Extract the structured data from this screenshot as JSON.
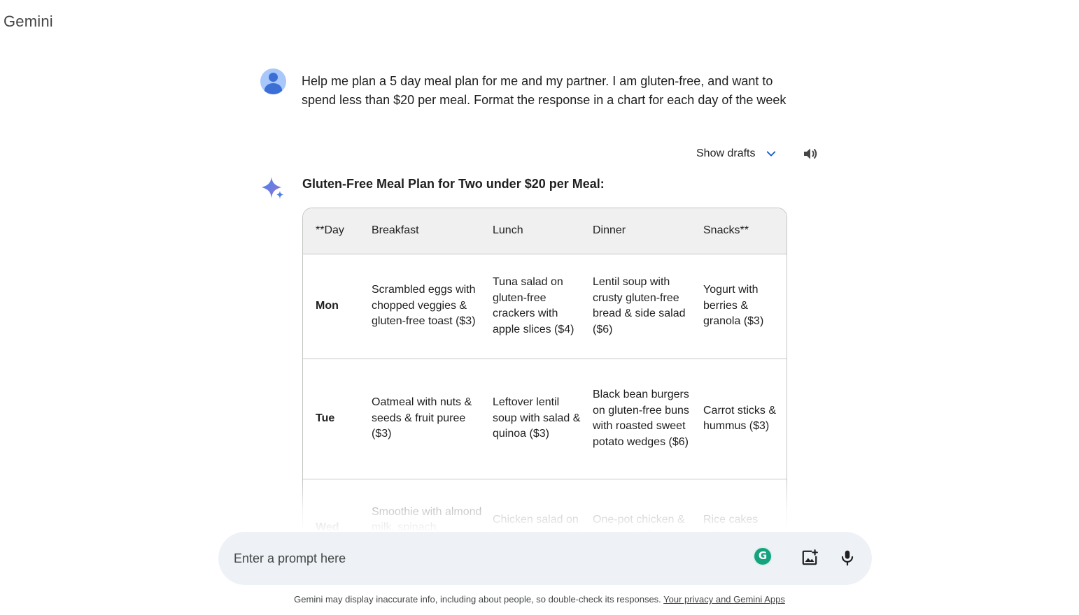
{
  "app": {
    "title": "Gemini"
  },
  "user_message": {
    "text": "Help me plan a 5 day meal plan for me and my partner. I am gluten-free, and want to spend less than $20 per meal. Format the response in a chart for each day of the week"
  },
  "drafts": {
    "label": "Show drafts",
    "icon": "chevron-down-icon"
  },
  "speaker": {
    "icon": "speaker-icon"
  },
  "response": {
    "title": "Gluten-Free Meal Plan for Two under $20 per Meal:",
    "table": {
      "headers": [
        "**Day",
        "Breakfast",
        "Lunch",
        "Dinner",
        "Snacks**"
      ],
      "rows": [
        [
          "Mon",
          "Scrambled eggs with chopped veggies & gluten-free toast ($3)",
          "Tuna salad on gluten-free crackers with apple slices ($4)",
          "Lentil soup with crusty gluten-free bread & side salad ($6)",
          "Yogurt with berries & granola ($3)"
        ],
        [
          "Tue",
          "Oatmeal with nuts & seeds & fruit puree ($3)",
          "Leftover lentil soup with salad & quinoa ($3)",
          "Black bean burgers on gluten-free buns with roasted sweet potato wedges ($6)",
          "Carrot sticks & hummus ($3)"
        ],
        [
          "Wed",
          "Smoothie with almond milk, spinach, banana, &",
          "Chicken salad on lettuce wraps with",
          "One-pot chicken & veggie stir-fry",
          "Rice cakes with avocado"
        ]
      ]
    }
  },
  "input": {
    "placeholder": "Enter a prompt here"
  },
  "footer": {
    "text": "Gemini may display inaccurate info, including about people, so double-check its responses. ",
    "link": "Your privacy and Gemini Apps"
  },
  "colors": {
    "accent": "#0b57d0",
    "input_bg": "#eef1f6",
    "grammarly": "#15a37f",
    "header_bg": "#f0f0f0"
  }
}
